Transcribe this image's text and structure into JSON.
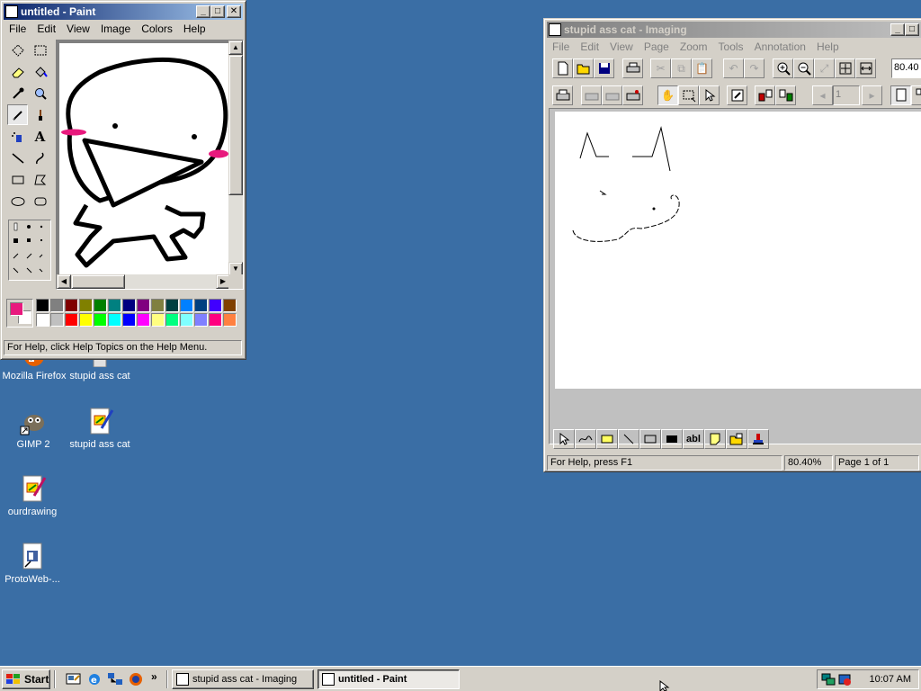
{
  "paint": {
    "title": "untitled - Paint",
    "menu": [
      "File",
      "Edit",
      "View",
      "Image",
      "Colors",
      "Help"
    ],
    "status": "For Help, click Help Topics on the Help Menu.",
    "tools": [
      "free-select",
      "rect-select",
      "eraser",
      "fill",
      "color-picker",
      "magnifier",
      "pencil",
      "brush",
      "airbrush",
      "text",
      "line",
      "curve",
      "rectangle",
      "polygon",
      "ellipse",
      "rounded-rectangle"
    ],
    "text_tool_glyph": "A",
    "foreground_color": "#e8197d",
    "background_color": "#ffffff",
    "palette_top": [
      "#000000",
      "#808080",
      "#800000",
      "#808000",
      "#008000",
      "#008080",
      "#000080",
      "#800080",
      "#808040",
      "#004040",
      "#0080ff",
      "#004080",
      "#4000ff",
      "#804000"
    ],
    "palette_bottom": [
      "#ffffff",
      "#c0c0c0",
      "#ff0000",
      "#ffff00",
      "#00ff00",
      "#00ffff",
      "#0000ff",
      "#ff00ff",
      "#ffff80",
      "#00ff80",
      "#80ffff",
      "#8080ff",
      "#ff0080",
      "#ff8040"
    ]
  },
  "imaging": {
    "title": "stupid ass cat - Imaging",
    "menu": [
      "File",
      "Edit",
      "View",
      "Page",
      "Zoom",
      "Tools",
      "Annotation",
      "Help"
    ],
    "zoom_value": "80.40",
    "page_value": "1",
    "status_help": "For Help, press F1",
    "status_zoom": "80.40%",
    "status_page": "Page 1 of 1",
    "text_tool_label": "abl"
  },
  "desktop": {
    "icons": [
      {
        "label": "Mozilla Firefox"
      },
      {
        "label": "stupid ass cat"
      },
      {
        "label": "GIMP 2"
      },
      {
        "label": "stupid ass cat"
      },
      {
        "label": "ourdrawing"
      },
      {
        "label": "ProtoWeb-..."
      }
    ]
  },
  "taskbar": {
    "start_label": "Start",
    "chevron": "»",
    "tasks": [
      {
        "label": "stupid ass cat - Imaging"
      },
      {
        "label": "untitled - Paint"
      }
    ],
    "clock": "10:07 AM"
  }
}
